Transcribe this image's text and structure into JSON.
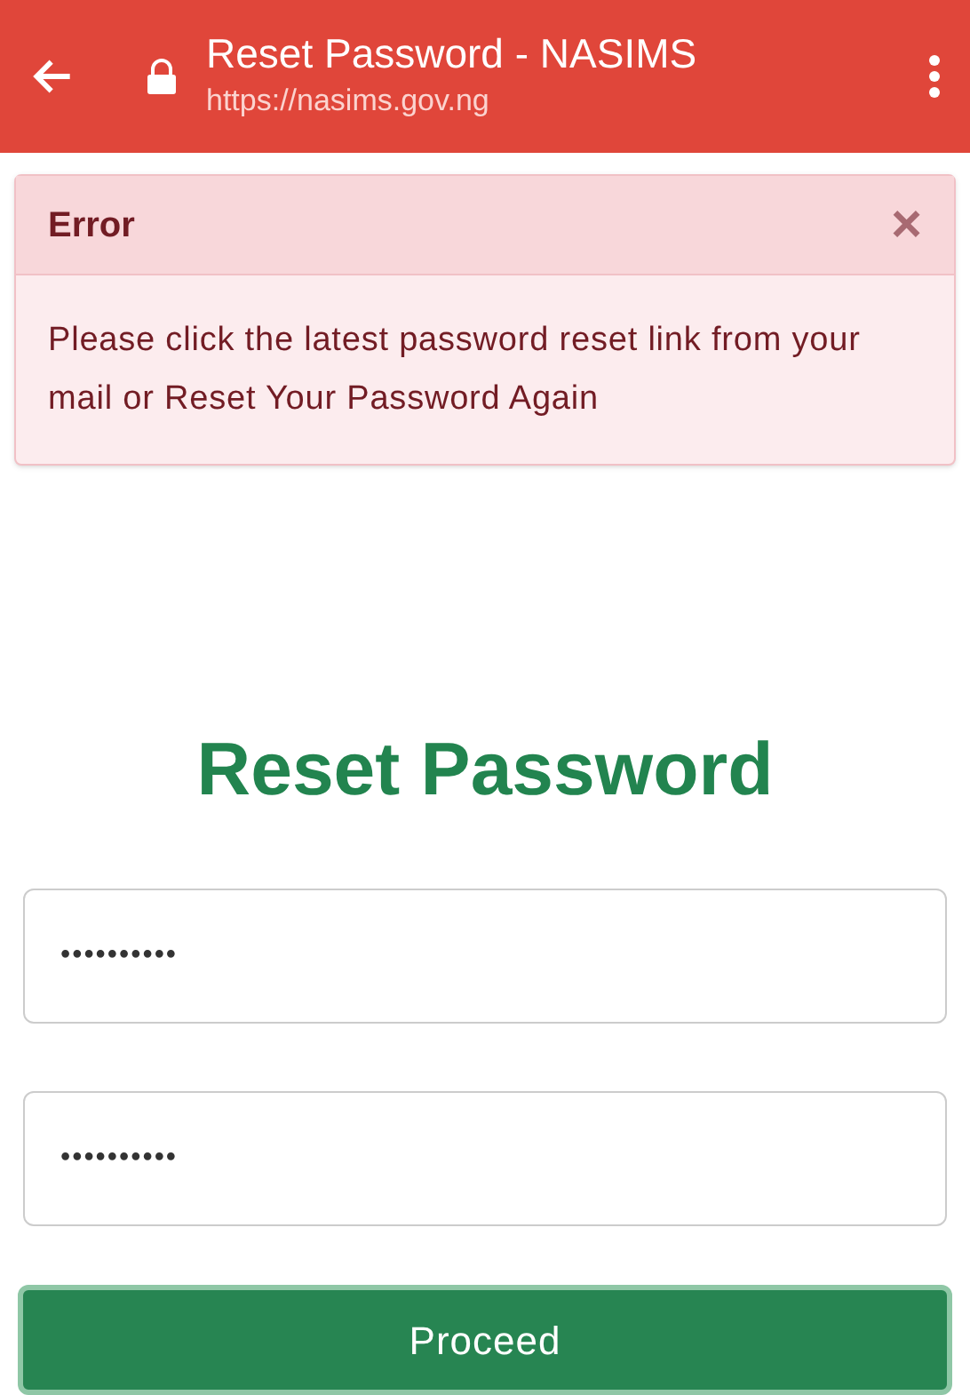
{
  "browser_bar": {
    "title": "Reset Password - NASIMS",
    "url": "https://nasims.gov.ng"
  },
  "alert": {
    "title": "Error",
    "close": "×",
    "message": "Please click the latest password reset link from your mail or Reset Your Password Again"
  },
  "heading": "Reset Password",
  "fields": [
    {
      "value": "••••••••••"
    },
    {
      "value": "••••••••••"
    }
  ],
  "button": "Proceed"
}
